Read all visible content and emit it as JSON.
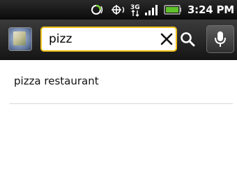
{
  "status_bar": {
    "network": "3G",
    "time": "3:24 PM"
  },
  "search": {
    "query": "pizz"
  },
  "suggestions": [
    {
      "label": "pizza restaurant"
    }
  ],
  "colors": {
    "focus_border": "#f1c21b",
    "toolbar_bg": "#1e1e1e"
  },
  "icons": {
    "source": "browser-source-icon",
    "clear": "close-icon",
    "search": "search-icon",
    "voice": "microphone-icon"
  }
}
